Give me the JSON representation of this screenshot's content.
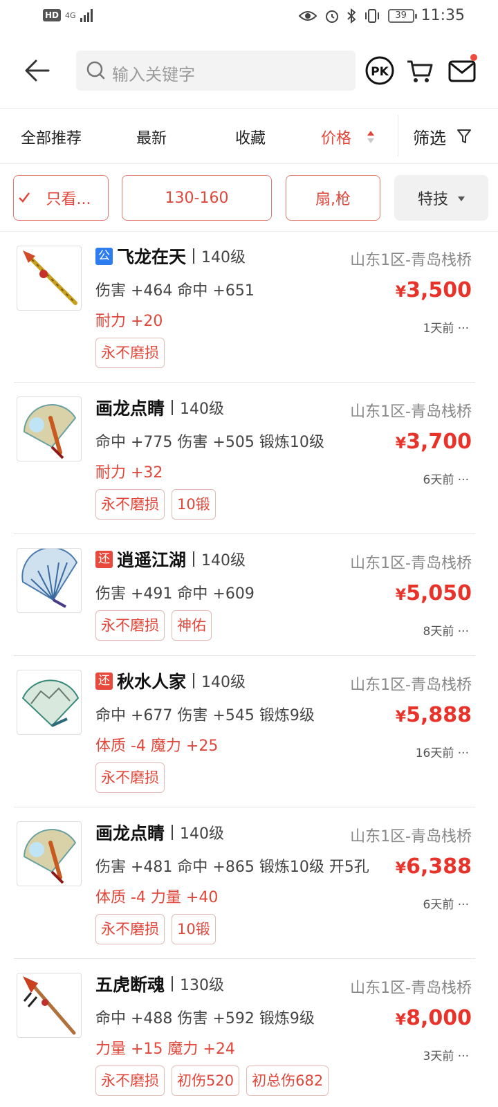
{
  "status_bar": {
    "hd": "HD",
    "network": "4G",
    "battery": "39",
    "time": "11:35"
  },
  "search": {
    "placeholder": "输入关键字"
  },
  "tabs": {
    "all": "全部推荐",
    "newest": "最新",
    "favorites": "收藏",
    "price": "价格",
    "filter": "筛选"
  },
  "chips": {
    "only_view": "只看...",
    "level_range": "130-160",
    "weapon_type": "扇,枪",
    "special_skill": "特技"
  },
  "colors": {
    "accent": "#e0473a",
    "price": "#e8332a",
    "badge_public": "#2d7cf0",
    "badge_return": "#e8493a"
  },
  "items": [
    {
      "badge": "公",
      "name": "飞龙在天",
      "level": "140级",
      "server": "山东1区-青岛栈桥",
      "stats": "伤害 +464 命中 +651",
      "extra": "耐力 +20",
      "price": "3,500",
      "ago": "1天前",
      "tags": [
        "永不磨损"
      ]
    },
    {
      "badge": "",
      "name": "画龙点睛",
      "level": "140级",
      "server": "山东1区-青岛栈桥",
      "stats": "命中 +775 伤害 +505 锻炼10级",
      "extra": "耐力 +32",
      "price": "3,700",
      "ago": "6天前",
      "tags": [
        "永不磨损",
        "10锻"
      ]
    },
    {
      "badge": "还",
      "name": "逍遥江湖",
      "level": "140级",
      "server": "山东1区-青岛栈桥",
      "stats": "伤害 +491 命中 +609",
      "extra": "",
      "price": "5,050",
      "ago": "8天前",
      "tags": [
        "永不磨损",
        "神佑"
      ]
    },
    {
      "badge": "还",
      "name": "秋水人家",
      "level": "140级",
      "server": "山东1区-青岛栈桥",
      "stats": "命中 +677 伤害 +545 锻炼9级",
      "extra": "体质 -4 魔力 +25",
      "price": "5,888",
      "ago": "16天前",
      "tags": [
        "永不磨损"
      ]
    },
    {
      "badge": "",
      "name": "画龙点睛",
      "level": "140级",
      "server": "山东1区-青岛栈桥",
      "stats": "伤害 +481 命中 +865 锻炼10级 开5孔",
      "extra": "体质 -4 力量 +40",
      "price": "6,388",
      "ago": "6天前",
      "tags": [
        "永不磨损",
        "10锻"
      ]
    },
    {
      "badge": "",
      "name": "五虎断魂",
      "level": "130级",
      "server": "山东1区-青岛栈桥",
      "stats": "命中 +488 伤害 +592 锻炼9级",
      "extra": "力量 +15 魔力 +24",
      "price": "8,000",
      "ago": "3天前",
      "tags": [
        "永不磨损",
        "初伤520",
        "初总伤682"
      ]
    }
  ],
  "currency": "¥",
  "more": "···"
}
